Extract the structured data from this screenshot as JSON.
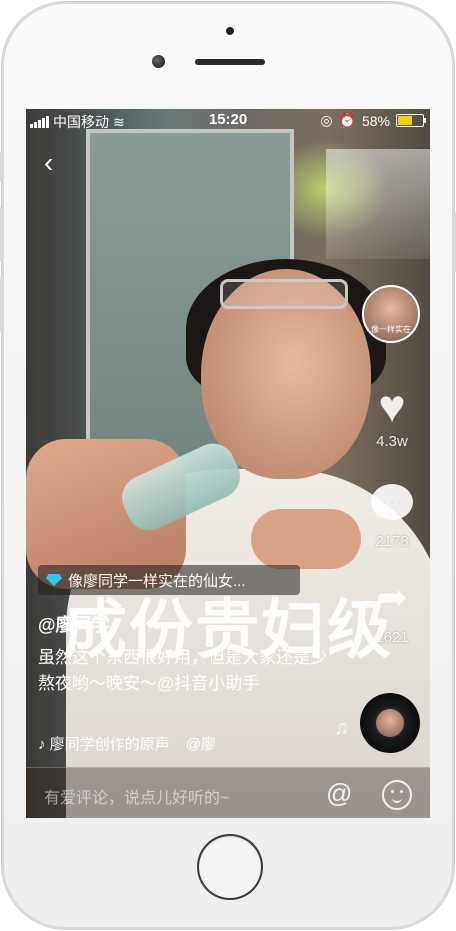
{
  "status_bar": {
    "carrier": "中国移动",
    "time": "15:20",
    "battery": "58%",
    "battery_level": 0.58
  },
  "video": {
    "watermark_text": "成份贵妇级"
  },
  "actions": {
    "likes": "4.3w",
    "comments": "2178",
    "shares": "2621",
    "avatar_caption": "像一样实在"
  },
  "promo": {
    "text": "像廖同学一样实在的仙女..."
  },
  "post": {
    "username": "@廖同学",
    "description": "虽然这个东西很好用，但是大家还是少熬夜哟～晚安～@抖音小助手",
    "music": "廖同学创作的原声",
    "music_author": "@廖"
  },
  "comment_bar": {
    "placeholder": "有爱评论，说点儿好听的~",
    "at_label": "@"
  }
}
